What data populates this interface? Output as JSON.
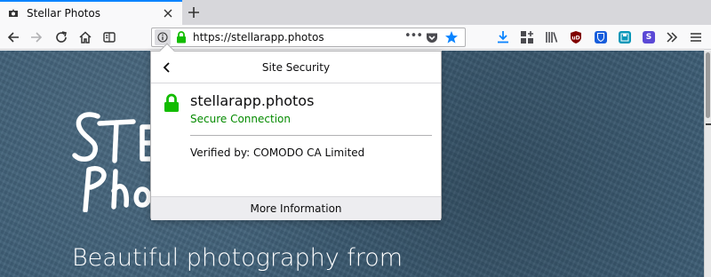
{
  "tab": {
    "title": "Stellar Photos",
    "favicon": "camera-icon"
  },
  "toolbar": {
    "back_icon": "back-arrow-icon",
    "forward_icon": "forward-arrow-icon",
    "reload_icon": "reload-icon",
    "home_icon": "home-icon",
    "reader_icon": "reader-view-icon"
  },
  "urlbar": {
    "url": "https://stellarapp.photos",
    "page_actions": "•••",
    "star_color": "#0a84ff"
  },
  "extensions": [
    {
      "name": "downloads-icon"
    },
    {
      "name": "extension-grid-icon"
    },
    {
      "name": "library-icon"
    },
    {
      "name": "ublock-icon",
      "label": "uD",
      "color": "#800000"
    },
    {
      "name": "bitwarden-icon",
      "color": "#175ddc"
    },
    {
      "name": "save-icon",
      "color": "#0997b8"
    },
    {
      "name": "s-extension-icon",
      "label": "S",
      "color": "#5b49d6"
    },
    {
      "name": "overflow-icon"
    },
    {
      "name": "menu-icon"
    }
  ],
  "page": {
    "logo_alt": "Stellar Photos logo",
    "hero_text": "Beautiful photography from"
  },
  "popup": {
    "title": "Site Security",
    "host": "stellarapp.photos",
    "status": "Secure Connection",
    "status_color": "#058b00",
    "verified": "Verified by: COMODO CA Limited",
    "more_info": "More Information"
  }
}
